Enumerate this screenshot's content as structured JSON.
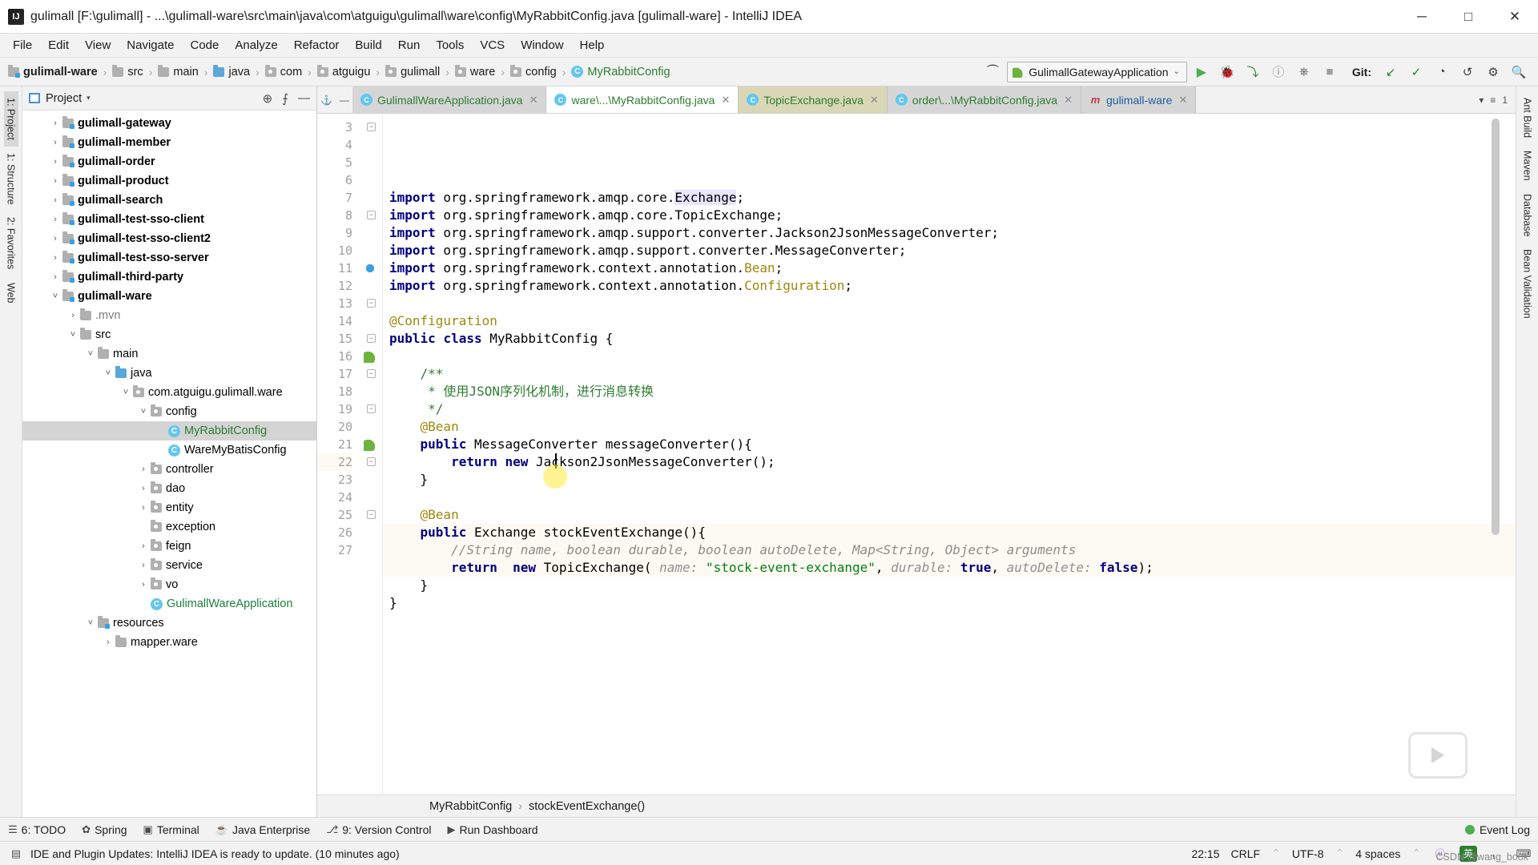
{
  "window": {
    "title": "gulimall [F:\\gulimall] - ...\\gulimall-ware\\src\\main\\java\\com\\atguigu\\gulimall\\ware\\config\\MyRabbitConfig.java [gulimall-ware] - IntelliJ IDEA",
    "logo_text": "IJ",
    "minimize": "─",
    "maximize": "□",
    "close": "✕"
  },
  "menubar": {
    "items": [
      "File",
      "Edit",
      "View",
      "Navigate",
      "Code",
      "Analyze",
      "Refactor",
      "Build",
      "Run",
      "Tools",
      "VCS",
      "Window",
      "Help"
    ]
  },
  "navbar": {
    "crumbs": [
      {
        "label": "gulimall-ware",
        "icon": "module-folder-icon",
        "bold": true
      },
      {
        "label": "src",
        "icon": "folder-icon",
        "bold": false
      },
      {
        "label": "main",
        "icon": "folder-icon",
        "bold": false
      },
      {
        "label": "java",
        "icon": "source-folder-icon",
        "bold": false
      },
      {
        "label": "com",
        "icon": "package-icon",
        "bold": false
      },
      {
        "label": "atguigu",
        "icon": "package-icon",
        "bold": false
      },
      {
        "label": "gulimall",
        "icon": "package-icon",
        "bold": false
      },
      {
        "label": "ware",
        "icon": "package-icon",
        "bold": false
      },
      {
        "label": "config",
        "icon": "package-icon",
        "bold": false
      },
      {
        "label": "MyRabbitConfig",
        "icon": "class-icon",
        "bold": false,
        "green": true
      }
    ],
    "separator": "›",
    "run_config": "GulimallGatewayApplication",
    "run_config_caret": "⌄",
    "buttons": [
      {
        "name": "run-button",
        "glyph": "▶"
      },
      {
        "name": "debug-button",
        "glyph": "🐞"
      },
      {
        "name": "run-with-coverage-button",
        "glyph": "⤵"
      },
      {
        "name": "profile-button",
        "glyph": "ⓘ"
      },
      {
        "name": "attach-process-button",
        "glyph": "⎇"
      },
      {
        "name": "stop-button",
        "glyph": "■"
      }
    ],
    "git_label": "Git:",
    "git_buttons": [
      {
        "name": "update-project-button",
        "glyph": "↙"
      },
      {
        "name": "commit-button",
        "glyph": "✓"
      },
      {
        "name": "history-button",
        "glyph": "◔"
      },
      {
        "name": "rollback-button",
        "glyph": "↺"
      },
      {
        "name": "open-settings-button",
        "glyph": "⚙"
      },
      {
        "name": "search-everywhere-button",
        "glyph": "🔍"
      }
    ]
  },
  "left_rail": {
    "items": [
      {
        "label": "1: Project",
        "active": true,
        "name": "tool-window-project"
      },
      {
        "label": "1: Structure",
        "active": false,
        "name": "tool-window-structure"
      },
      {
        "label": "2: Favorites",
        "active": false,
        "name": "tool-window-favorites"
      },
      {
        "label": "Web",
        "active": false,
        "name": "tool-window-web"
      }
    ]
  },
  "right_rail": {
    "items": [
      {
        "label": "Ant Build",
        "name": "tool-window-ant-build"
      },
      {
        "label": "Maven",
        "name": "tool-window-maven"
      },
      {
        "label": "Database",
        "name": "tool-window-database"
      },
      {
        "label": "Bean Validation",
        "name": "tool-window-bean-validation"
      }
    ]
  },
  "project_panel": {
    "title": "Project",
    "caret": "▾",
    "actions": [
      {
        "name": "select-opened-file-icon",
        "glyph": "⊕"
      },
      {
        "name": "collapse-all-icon",
        "glyph": "⨍"
      },
      {
        "name": "hide-panel-icon",
        "glyph": "—"
      }
    ],
    "tree": [
      {
        "indent": 1,
        "arrow": "›",
        "icon": "module-folder",
        "label": "gulimall-gateway",
        "bold": true
      },
      {
        "indent": 1,
        "arrow": "›",
        "icon": "module-folder",
        "label": "gulimall-member",
        "bold": true
      },
      {
        "indent": 1,
        "arrow": "›",
        "icon": "module-folder",
        "label": "gulimall-order",
        "bold": true
      },
      {
        "indent": 1,
        "arrow": "›",
        "icon": "module-folder",
        "label": "gulimall-product",
        "bold": true
      },
      {
        "indent": 1,
        "arrow": "›",
        "icon": "module-folder",
        "label": "gulimall-search",
        "bold": true
      },
      {
        "indent": 1,
        "arrow": "›",
        "icon": "module-folder",
        "label": "gulimall-test-sso-client",
        "bold": true
      },
      {
        "indent": 1,
        "arrow": "›",
        "icon": "module-folder",
        "label": "gulimall-test-sso-client2",
        "bold": true
      },
      {
        "indent": 1,
        "arrow": "›",
        "icon": "module-folder",
        "label": "gulimall-test-sso-server",
        "bold": true
      },
      {
        "indent": 1,
        "arrow": "›",
        "icon": "module-folder",
        "label": "gulimall-third-party",
        "bold": true
      },
      {
        "indent": 1,
        "arrow": "˅",
        "icon": "module-folder",
        "label": "gulimall-ware",
        "bold": true
      },
      {
        "indent": 2,
        "arrow": "›",
        "icon": "folder",
        "label": ".mvn",
        "gray": true
      },
      {
        "indent": 2,
        "arrow": "˅",
        "icon": "folder",
        "label": "src"
      },
      {
        "indent": 3,
        "arrow": "˅",
        "icon": "folder",
        "label": "main"
      },
      {
        "indent": 4,
        "arrow": "˅",
        "icon": "source-folder",
        "label": "java"
      },
      {
        "indent": 5,
        "arrow": "˅",
        "icon": "package",
        "label": "com.atguigu.gulimall.ware"
      },
      {
        "indent": 6,
        "arrow": "˅",
        "icon": "package",
        "label": "config"
      },
      {
        "indent": 7,
        "arrow": "",
        "icon": "class",
        "label": "MyRabbitConfig",
        "selected": true,
        "green": true
      },
      {
        "indent": 7,
        "arrow": "",
        "icon": "class",
        "label": "WareMyBatisConfig"
      },
      {
        "indent": 6,
        "arrow": "›",
        "icon": "package",
        "label": "controller"
      },
      {
        "indent": 6,
        "arrow": "›",
        "icon": "package",
        "label": "dao"
      },
      {
        "indent": 6,
        "arrow": "›",
        "icon": "package",
        "label": "entity"
      },
      {
        "indent": 6,
        "arrow": "",
        "icon": "package",
        "label": "exception"
      },
      {
        "indent": 6,
        "arrow": "›",
        "icon": "package",
        "label": "feign"
      },
      {
        "indent": 6,
        "arrow": "›",
        "icon": "package",
        "label": "service"
      },
      {
        "indent": 6,
        "arrow": "›",
        "icon": "package",
        "label": "vo"
      },
      {
        "indent": 6,
        "arrow": "",
        "icon": "class",
        "label": "GulimallWareApplication",
        "greenblue": true
      },
      {
        "indent": 3,
        "arrow": "˅",
        "icon": "resources-folder",
        "label": "resources"
      },
      {
        "indent": 4,
        "arrow": "›",
        "icon": "folder",
        "label": "mapper.ware"
      }
    ]
  },
  "editor": {
    "tabs": [
      {
        "label": "GulimallWareApplication.java",
        "icon": "class-icon",
        "state": "inactive",
        "color": "green",
        "close": "✕"
      },
      {
        "label": "ware\\...\\MyRabbitConfig.java",
        "icon": "class-icon",
        "state": "active",
        "color": "green",
        "close": "✕"
      },
      {
        "label": "TopicExchange.java",
        "icon": "class-icon",
        "state": "modified",
        "color": "green",
        "close": "✕"
      },
      {
        "label": "order\\...\\MyRabbitConfig.java",
        "icon": "class-icon",
        "state": "inactive",
        "color": "green",
        "close": "✕"
      },
      {
        "label": "gulimall-ware",
        "icon": "maven-icon",
        "state": "inactive",
        "color": "blue",
        "close": "✕"
      }
    ],
    "tabs_right": [
      {
        "name": "tab-list-icon",
        "glyph": "▾"
      },
      {
        "name": "tab-layout-icon",
        "glyph": "≡"
      },
      {
        "name": "tab-count-label",
        "glyph": "1"
      }
    ],
    "first_line_number": 3,
    "lines": [
      {
        "n": 3,
        "fold": "minus",
        "segs": [
          {
            "t": "import",
            "c": "kw"
          },
          {
            "t": " org.springframework.amqp.core."
          },
          {
            "t": "Exchange",
            "c": "hl-ident"
          },
          {
            "t": ";"
          }
        ]
      },
      {
        "n": 4,
        "segs": [
          {
            "t": "import",
            "c": "kw"
          },
          {
            "t": " org.springframework.amqp.core.TopicExchange;"
          }
        ]
      },
      {
        "n": 5,
        "segs": [
          {
            "t": "import",
            "c": "kw"
          },
          {
            "t": " org.springframework.amqp.support.converter.Jackson2JsonMessageConverter;"
          }
        ]
      },
      {
        "n": 6,
        "segs": [
          {
            "t": "import",
            "c": "kw"
          },
          {
            "t": " org.springframework.amqp.support.converter.MessageConverter;"
          }
        ]
      },
      {
        "n": 7,
        "segs": [
          {
            "t": "import",
            "c": "kw"
          },
          {
            "t": " org.springframework.context.annotation."
          },
          {
            "t": "Bean",
            "c": "ann"
          },
          {
            "t": ";"
          }
        ]
      },
      {
        "n": 8,
        "fold": "minus",
        "segs": [
          {
            "t": "import",
            "c": "kw"
          },
          {
            "t": " org.springframework.context.annotation."
          },
          {
            "t": "Configuration",
            "c": "ann"
          },
          {
            "t": ";"
          }
        ]
      },
      {
        "n": 9,
        "segs": []
      },
      {
        "n": 10,
        "segs": [
          {
            "t": "@Configuration",
            "c": "ann"
          }
        ]
      },
      {
        "n": 11,
        "mark": "class",
        "segs": [
          {
            "t": "public",
            "c": "kw"
          },
          {
            "t": " "
          },
          {
            "t": "class",
            "c": "kw"
          },
          {
            "t": " MyRabbitConfig {"
          }
        ]
      },
      {
        "n": 12,
        "segs": []
      },
      {
        "n": 13,
        "fold": "minus",
        "segs": [
          {
            "t": "    /**",
            "c": "jdoc"
          }
        ]
      },
      {
        "n": 14,
        "segs": [
          {
            "t": "     * 使用JSON序列化机制，进行消息转换",
            "c": "jdoc"
          }
        ]
      },
      {
        "n": 15,
        "fold": "minus",
        "segs": [
          {
            "t": "     */",
            "c": "jdoc"
          }
        ]
      },
      {
        "n": 16,
        "mark": "bean",
        "segs": [
          {
            "t": "    @Bean",
            "c": "ann"
          }
        ]
      },
      {
        "n": 17,
        "fold": "minus",
        "segs": [
          {
            "t": "    "
          },
          {
            "t": "public",
            "c": "kw"
          },
          {
            "t": " MessageConverter messageConverter(){"
          }
        ]
      },
      {
        "n": 18,
        "segs": [
          {
            "t": "        "
          },
          {
            "t": "return",
            "c": "kw"
          },
          {
            "t": " "
          },
          {
            "t": "new",
            "c": "kw"
          },
          {
            "t": " Jackson2JsonMessageConverter();"
          }
        ]
      },
      {
        "n": 19,
        "fold": "minus",
        "segs": [
          {
            "t": "    }"
          }
        ]
      },
      {
        "n": 20,
        "segs": []
      },
      {
        "n": 21,
        "mark": "bean",
        "segs": [
          {
            "t": "    @Bean",
            "c": "ann"
          }
        ]
      },
      {
        "n": 22,
        "fold": "minus",
        "caret": true,
        "segs": [
          {
            "t": "    "
          },
          {
            "t": "public",
            "c": "kw"
          },
          {
            "t": " Exchange stockEventExchange(){"
          }
        ]
      },
      {
        "n": 23,
        "caret_bg": true,
        "segs": [
          {
            "t": "        //String name, boolean durable, boolean autoDelete, Map<String, Object> arguments",
            "c": "cmt"
          }
        ]
      },
      {
        "n": 24,
        "caret_bg": true,
        "segs": [
          {
            "t": "        "
          },
          {
            "t": "return",
            "c": "kw"
          },
          {
            "t": "  "
          },
          {
            "t": "new",
            "c": "kw"
          },
          {
            "t": " TopicExchange( "
          },
          {
            "t": "name:",
            "c": "hint"
          },
          {
            "t": " "
          },
          {
            "t": "\"stock-event-exchange\"",
            "c": "str"
          },
          {
            "t": ", "
          },
          {
            "t": "durable:",
            "c": "hint"
          },
          {
            "t": " "
          },
          {
            "t": "true",
            "c": "kw"
          },
          {
            "t": ", "
          },
          {
            "t": "autoDelete:",
            "c": "hint"
          },
          {
            "t": " "
          },
          {
            "t": "false",
            "c": "kw"
          },
          {
            "t": ");"
          }
        ]
      },
      {
        "n": 25,
        "fold": "minus",
        "segs": [
          {
            "t": "    }"
          }
        ]
      },
      {
        "n": 26,
        "segs": [
          {
            "t": "}"
          }
        ]
      },
      {
        "n": 27,
        "segs": []
      }
    ],
    "bottom_breadcrumb": [
      {
        "label": "MyRabbitConfig"
      },
      {
        "label": "stockEventExchange()"
      }
    ],
    "bottom_breadcrumb_sep": "›"
  },
  "bottom_toolbar": {
    "items": [
      {
        "label": "6: TODO",
        "icon": "todo-icon",
        "glyph": "☰"
      },
      {
        "label": "Spring",
        "icon": "spring-icon",
        "glyph": "✿"
      },
      {
        "label": "Terminal",
        "icon": "terminal-icon",
        "glyph": "▣"
      },
      {
        "label": "Java Enterprise",
        "icon": "java-enterprise-icon",
        "glyph": "☕"
      },
      {
        "label": "9: Version Control",
        "icon": "version-control-icon",
        "glyph": "⎇"
      },
      {
        "label": "Run Dashboard",
        "icon": "run-dashboard-icon",
        "glyph": "▶"
      }
    ],
    "event_log": {
      "label": "Event Log",
      "glyph": "●"
    }
  },
  "statusbar": {
    "left_icon": "▤",
    "message": "IDE and Plugin Updates: IntelliJ IDEA is ready to update. (10 minutes ago)",
    "caret_position": "22:15",
    "line_separator": "CRLF",
    "line_separator_caret": "⌃",
    "encoding": "UTF-8",
    "encoding_caret": "⌃",
    "indent": "4 spaces",
    "indent_caret": "⌃",
    "ime": {
      "logo": "ⓤ",
      "lang": "英",
      "punct": "，",
      "tool": "⌨"
    },
    "watermark": "CSDN @wang_book"
  }
}
